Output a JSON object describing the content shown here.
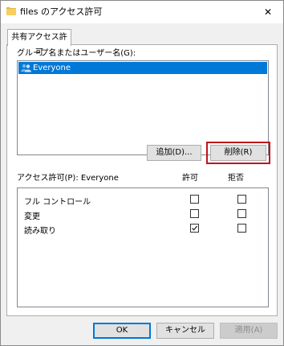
{
  "window": {
    "title": "files のアクセス許可",
    "close_glyph": "✕"
  },
  "tab": {
    "label": "共有アクセス許可"
  },
  "users": {
    "label": "グループ名またはユーザー名(G):",
    "items": [
      {
        "name": "Everyone",
        "icon": "users-icon"
      }
    ],
    "add_button": "追加(D)...",
    "remove_button": "削除(R)"
  },
  "permissions": {
    "label": "アクセス許可(P): Everyone",
    "allow_header": "許可",
    "deny_header": "拒否",
    "rows": [
      {
        "name": "フル コントロール",
        "allow": false,
        "deny": false
      },
      {
        "name": "変更",
        "allow": false,
        "deny": false
      },
      {
        "name": "読み取り",
        "allow": true,
        "deny": false
      }
    ]
  },
  "footer": {
    "ok": "OK",
    "cancel": "キャンセル",
    "apply": "適用(A)"
  },
  "colors": {
    "selection": "#0078d7",
    "highlight_border": "#c0141b"
  }
}
